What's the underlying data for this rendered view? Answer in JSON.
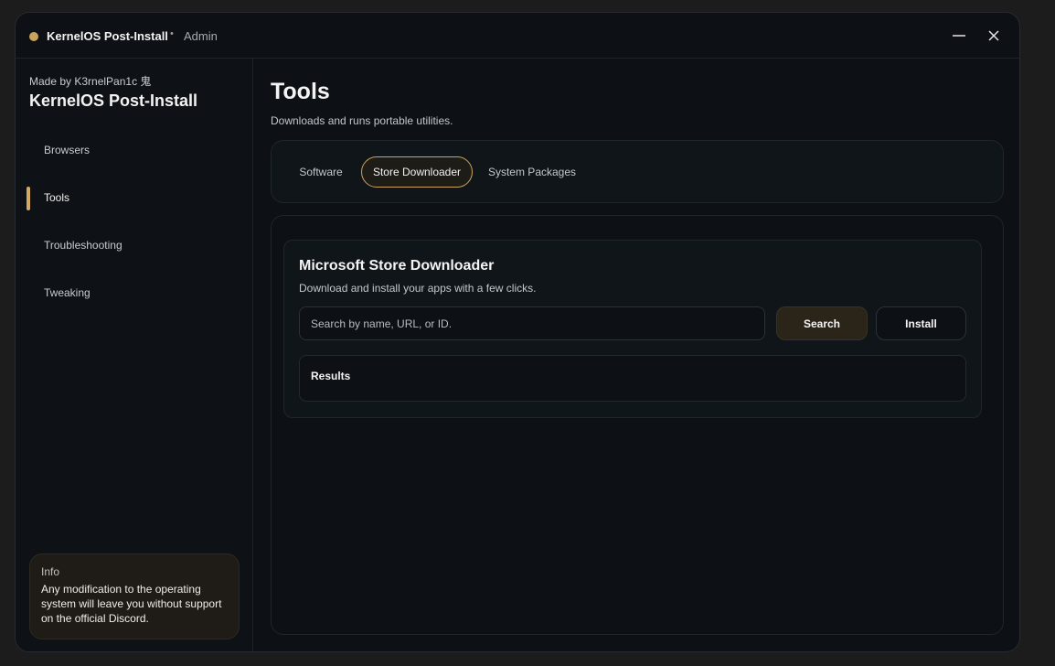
{
  "window": {
    "title": "KernelOS Post-Install",
    "separator": "•",
    "role": "Admin",
    "status_color": "#c9a45c",
    "minimize_icon": "minimize-icon",
    "close_icon": "close-icon"
  },
  "sidebar": {
    "credit": "Made by K3rnelPan1c 鬼",
    "title": "KernelOS Post-Install",
    "items": [
      {
        "label": "Browsers",
        "active": false
      },
      {
        "label": "Tools",
        "active": true
      },
      {
        "label": "Troubleshooting",
        "active": false
      },
      {
        "label": "Tweaking",
        "active": false
      }
    ],
    "info": {
      "title": "Info",
      "text": "Any modification to the operating system will leave you without support on the official Discord."
    }
  },
  "main": {
    "title": "Tools",
    "subtitle": "Downloads and runs portable utilities.",
    "tabs": [
      {
        "label": "Software",
        "active": false
      },
      {
        "label": "Store Downloader",
        "active": true
      },
      {
        "label": "System Packages",
        "active": false
      }
    ],
    "panel": {
      "title": "Microsoft Store Downloader",
      "subtitle": "Download and install your apps with a few clicks.",
      "search_placeholder": "Search by name, URL, or ID.",
      "search_value": "",
      "search_button": "Search",
      "install_button": "Install",
      "results_title": "Results"
    }
  },
  "colors": {
    "accent": "#d4aa62",
    "background": "#0d1014"
  }
}
